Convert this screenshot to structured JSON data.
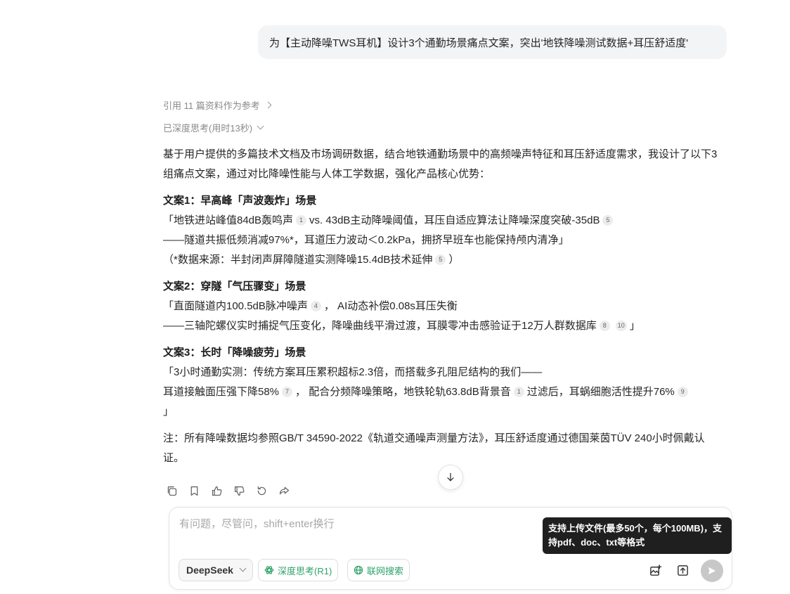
{
  "user_message": "为【主动降噪TWS耳机】设计3个通勤场景痛点文案，突出'地铁降噪测试数据+耳压舒适度'",
  "references_label": "引用 11 篇资料作为参考",
  "thinking_label": "已深度思考(用时13秒)",
  "answer": {
    "intro": "基于用户提供的多篇技术文档及市场调研数据，结合地铁通勤场景中的高频噪声特征和耳压舒适度需求，我设计了以下3组痛点文案，通过对比降噪性能与人体工学数据，强化产品核心优势：",
    "s1": {
      "title": "文案1：早高峰「声波轰炸」场景",
      "l1a": "「地铁进站峰值84dB轰鸣声",
      "c1": "1",
      "l1b": "vs. 43dB主动降噪阈值，耳压自适应算法让降噪深度突破-35dB",
      "c2": "5",
      "l2": "——隧道共振低频消减97%*，耳道压力波动＜0.2kPa，拥挤早班车也能保持颅内清净」",
      "l3a": "（*数据来源：半封闭声屏障隧道实测降噪15.4dB技术延伸",
      "c3": "5",
      "l3b": "）"
    },
    "s2": {
      "title": "文案2：穿隧「气压骤变」场景",
      "l1a": "「直面隧道内100.5dB脉冲噪声",
      "c1": "4",
      "l1b": "， AI动态补偿0.08s耳压失衡",
      "l2a": "——三轴陀螺仪实时捕捉气压变化，降噪曲线平滑过渡，耳膜零冲击感验证于12万人群数据库",
      "c2": "8",
      "c3": "10",
      "l2b": "」"
    },
    "s3": {
      "title": "文案3：长时「降噪疲劳」场景",
      "l1": "「3小时通勤实测：传统方案耳压累积超标2.3倍，而搭载多孔阻尼结构的我们——",
      "l2a": "耳道接触面压强下降58%",
      "c1": "7",
      "l2b": "， 配合分频降噪策略，地铁轮轨63.8dB背景音",
      "c2": "1",
      "l2c": "过滤后，耳蜗细胞活性提升76%",
      "c3": "9",
      "l3": "」"
    },
    "note": "注：所有降噪数据均参照GB/T 34590-2022《轨道交通噪声测量方法》，耳压舒适度通过德国莱茵TÜV 240小时佩戴认证。"
  },
  "actions": [
    "copy-icon",
    "bookmark-icon",
    "thumbs-up-icon",
    "thumbs-down-icon",
    "regenerate-icon",
    "share-icon"
  ],
  "composer": {
    "placeholder": "有问题，尽管问，shift+enter换行",
    "model": "DeepSeek",
    "deep_think": "深度思考(R1)",
    "web_search": "联网搜索",
    "tooltip": "支持上传文件(最多50个，每个100MB)，支持pdf、doc、txt等格式"
  },
  "colors": {
    "accent_green": "#2fa36b",
    "bubble_bg": "#f3f4f6",
    "tooltip_bg": "#1f1f1f"
  }
}
